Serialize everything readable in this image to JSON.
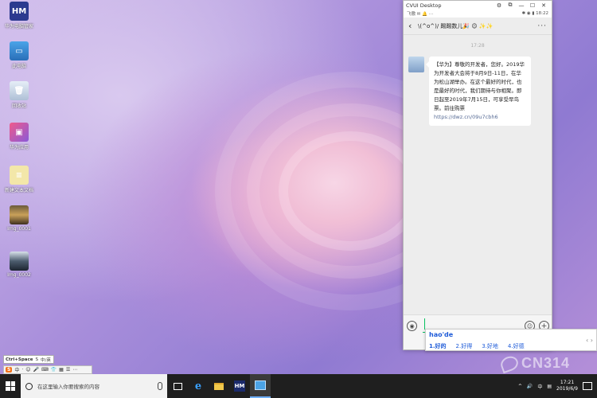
{
  "desktop": {
    "icons": [
      {
        "label": "华为电脑管家",
        "glyph": "HM"
      },
      {
        "label": "此电脑",
        "glyph": "▭"
      },
      {
        "label": "回收站",
        "glyph": "🗑"
      },
      {
        "label": "华为应用",
        "glyph": "▣"
      },
      {
        "label": "新建文本文档",
        "glyph": "≡"
      },
      {
        "label": "Img_0001",
        "glyph": ""
      },
      {
        "label": "Img_0002",
        "glyph": ""
      }
    ]
  },
  "phone_window": {
    "title": "CVUI Desktop",
    "controls": [
      "⚙",
      "⧉",
      "—",
      "☐",
      "✕"
    ],
    "status_left": "飞傲 ✉ 🔔 ⋯",
    "status_right": "✱ ◉ ▮ 18:22",
    "chat": {
      "back": "‹",
      "contact": "\\(^o^)/ 踢踢数儿🎉 😉 ✨✨",
      "more": "···",
      "timestamp": "17:28",
      "message": {
        "text": "【华为】尊敬的开发者，您好。2019华为开发者大会将于8月9日-11日，在华为松山湖举办。在这个最好的时代，也是最好的时代，我们期待与你相聚。即日起至2019年7月15日，可享受早鸟票。前往购票",
        "link": "https://dwz.cn/09u7cbh6"
      },
      "input_value": ""
    }
  },
  "ime": {
    "pinyin": "hao'de",
    "candidates": [
      "1.好的",
      "2.好得",
      "3.好地",
      "4.好德"
    ],
    "nav": "‹ ›"
  },
  "tray_popups": {
    "upper": [
      "Ctrl+Space",
      "S",
      "中/英"
    ],
    "lower": [
      "S",
      "中",
      "·",
      "☺",
      "🎤",
      "⌨",
      "👕",
      "▦",
      "☰",
      "⋯"
    ]
  },
  "taskbar": {
    "search_placeholder": "在这里输入你要搜索的内容",
    "clock_time": "17:21",
    "clock_date": "2019/6/9",
    "tray_icons": [
      "^",
      "🔊",
      "中",
      "▤"
    ]
  },
  "watermark": "CN314"
}
